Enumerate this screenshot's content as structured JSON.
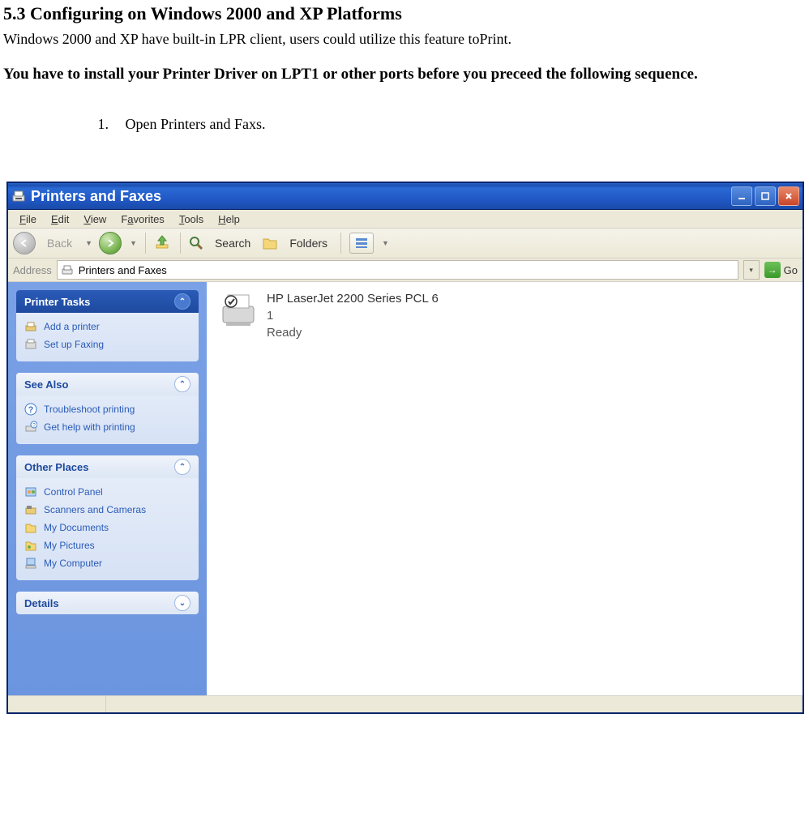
{
  "section": {
    "heading": "5.3 Configuring on Windows 2000 and XP Platforms",
    "intro": "Windows 2000 and XP have built-in LPR client, users could utilize this feature toPrint.",
    "note": "You have to install your Printer Driver on LPT1 or other ports before you preceed the following sequence.",
    "step_num": "1.",
    "step_text": "Open Printers and Faxs."
  },
  "xp": {
    "title": "Printers and Faxes",
    "menu": {
      "file": "File",
      "edit": "Edit",
      "view": "View",
      "favorites": "Favorites",
      "tools": "Tools",
      "help": "Help"
    },
    "toolbar": {
      "back": "Back",
      "search": "Search",
      "folders": "Folders"
    },
    "address": {
      "label": "Address",
      "value": "Printers and Faxes",
      "go": "Go"
    },
    "sidebar": {
      "printer_tasks": {
        "title": "Printer Tasks",
        "items": [
          "Add a printer",
          "Set up Faxing"
        ]
      },
      "see_also": {
        "title": "See Also",
        "items": [
          "Troubleshoot printing",
          "Get help with printing"
        ]
      },
      "other_places": {
        "title": "Other Places",
        "items": [
          "Control Panel",
          "Scanners and Cameras",
          "My Documents",
          "My Pictures",
          "My Computer"
        ]
      },
      "details": {
        "title": "Details"
      }
    },
    "printer": {
      "name": "HP LaserJet 2200 Series PCL 6",
      "docs": "1",
      "status": "Ready"
    }
  }
}
